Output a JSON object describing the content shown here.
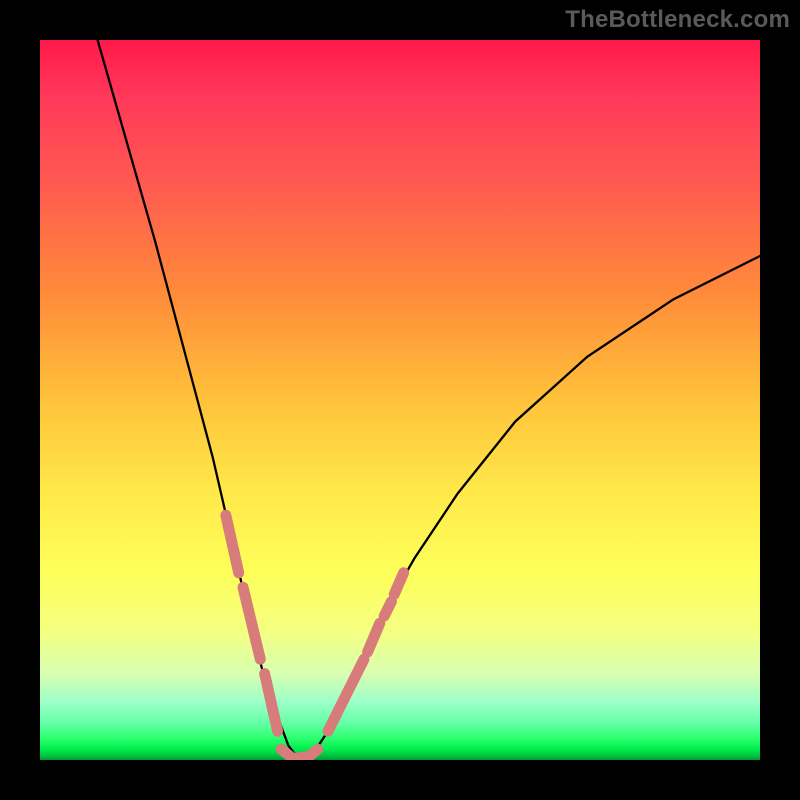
{
  "watermark": "TheBottleneck.com",
  "chart_data": {
    "type": "line",
    "title": "",
    "xlabel": "",
    "ylabel": "",
    "xlim": [
      0,
      100
    ],
    "ylim": [
      0,
      100
    ],
    "legend": false,
    "grid": false,
    "note": "Bottleneck V-curve; bottleneck percentage (y, 0 at bottom) vs component balance (x). Vertical gradient encodes severity: green=no bottleneck, red=severe. Salmon segments highlight near-optimal region. Values read from pixel position.",
    "series": [
      {
        "name": "bottleneck-curve-left",
        "x": [
          8,
          12,
          16,
          20,
          24,
          27,
          29,
          31,
          33,
          34.5,
          36
        ],
        "values": [
          100,
          86,
          72,
          57,
          42,
          29,
          20,
          12,
          6,
          2,
          0
        ]
      },
      {
        "name": "bottleneck-curve-right",
        "x": [
          36,
          38,
          40,
          42.5,
          45,
          48,
          52,
          58,
          66,
          76,
          88,
          100
        ],
        "values": [
          0,
          1,
          4,
          9,
          14,
          21,
          28,
          37,
          47,
          56,
          64,
          70
        ]
      },
      {
        "name": "highlighted-segments-left",
        "x": [
          25.8,
          27.6,
          28.2,
          30.6,
          31.2,
          33.0
        ],
        "values": [
          34,
          26,
          24,
          14,
          12,
          4
        ]
      },
      {
        "name": "highlighted-segments-right",
        "x": [
          40.0,
          45.0,
          45.5,
          47.2,
          47.8,
          48.8,
          49.2,
          50.5
        ],
        "values": [
          4,
          14,
          15,
          19,
          20,
          22,
          23,
          26
        ]
      },
      {
        "name": "highlighted-bottom",
        "x": [
          33.5,
          35.0,
          35.4,
          37.2,
          37.6,
          38.6
        ],
        "values": [
          1.5,
          0.3,
          0.2,
          0.5,
          0.7,
          1.5
        ]
      }
    ],
    "gradient_stops": [
      {
        "pos": 0,
        "color": "#ff1a4b",
        "meaning": "severe bottleneck"
      },
      {
        "pos": 50,
        "color": "#ffc23a"
      },
      {
        "pos": 75,
        "color": "#feff5a"
      },
      {
        "pos": 95,
        "color": "#62ffa5"
      },
      {
        "pos": 100,
        "color": "#009a33",
        "meaning": "no bottleneck"
      }
    ],
    "highlight_color": "#d77b7b"
  }
}
